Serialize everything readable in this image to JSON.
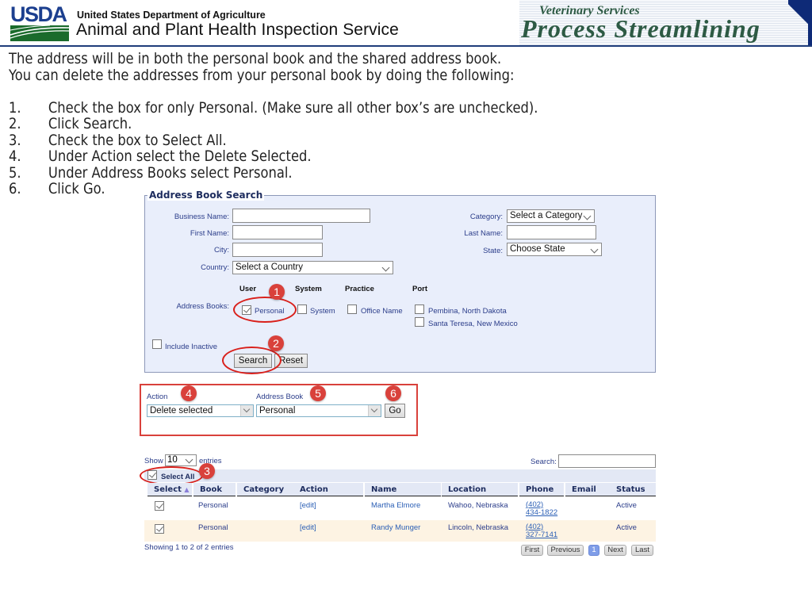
{
  "header": {
    "logo_text": "USDA",
    "department": "United States Department of Agriculture",
    "agency": "Animal and Plant Health Inspection Service",
    "banner_small": "Veterinary Services",
    "banner_large": "Process Streamlining",
    "colors": {
      "usda_blue": "#1c3f8f",
      "usda_green": "#1b6b2c",
      "banner_text": "#2d5a44",
      "banner_corner": "#0e2a77"
    }
  },
  "instructions": {
    "intro_line1": "The address will be in both the personal book and the shared address book.",
    "intro_line2": "You can delete the addresses from your personal book by doing the following:",
    "steps": [
      {
        "num": "1.",
        "text": "Check the box for only Personal.  (Make sure all other box’s are unchecked)."
      },
      {
        "num": "2.",
        "text": "Click Search."
      },
      {
        "num": "3.",
        "text": "Check the box to Select All."
      },
      {
        "num": "4.",
        "text": "Under Action select the Delete Selected."
      },
      {
        "num": "5.",
        "text": "Under Address Books select Personal."
      },
      {
        "num": "6.",
        "text": "Click Go."
      }
    ]
  },
  "search_form": {
    "legend": "Address Book Search",
    "business_name_label": "Business Name:",
    "business_name_value": "",
    "first_name_label": "First Name:",
    "first_name_value": "",
    "city_label": "City:",
    "city_value": "",
    "country_label": "Country:",
    "country_value": "Select a Country",
    "category_label": "Category:",
    "category_value": "Select a Category",
    "last_name_label": "Last Name:",
    "last_name_value": "",
    "state_label": "State:",
    "state_value": "Choose State",
    "address_books_label": "Address Books:",
    "group_headers": [
      "User",
      "System",
      "Practice",
      "Port"
    ],
    "book_options": [
      {
        "label": "Personal",
        "checked": true
      },
      {
        "label": "System",
        "checked": false
      },
      {
        "label": "Office Name",
        "checked": false
      },
      {
        "label": "Pembina, North Dakota",
        "checked": false
      },
      {
        "label": "Santa Teresa, New Mexico",
        "checked": false
      }
    ],
    "include_inactive_label": "Include Inactive",
    "include_inactive_checked": false,
    "search_button": "Search",
    "reset_button": "Reset"
  },
  "action_bar": {
    "action_label": "Action",
    "action_value": "Delete selected",
    "address_book_label": "Address Book",
    "address_book_value": "Personal",
    "go_button": "Go"
  },
  "callouts": [
    "1",
    "2",
    "3",
    "4",
    "5",
    "6"
  ],
  "results": {
    "show_label": "Show",
    "show_value": "10",
    "entries_label": "entries",
    "search_label": "Search:",
    "search_value": "",
    "select_all_label": "Select All",
    "select_all_checked": true,
    "columns": [
      "Select",
      "Book",
      "Category",
      "Action",
      "Name",
      "Location",
      "Phone",
      "Email",
      "Status"
    ],
    "rows": [
      {
        "checked": true,
        "book": "Personal",
        "category": "",
        "action": "[edit]",
        "name": "Martha Elmore",
        "location": "Wahoo, Nebraska",
        "phone_area": "(402)",
        "phone_number": "434-1822",
        "email": "",
        "status": "Active"
      },
      {
        "checked": true,
        "book": "Personal",
        "category": "",
        "action": "[edit]",
        "name": "Randy Munger",
        "location": "Lincoln, Nebraska",
        "phone_area": "(402)",
        "phone_number": "327-7141",
        "email": "",
        "status": "Active"
      }
    ],
    "info": "Showing 1 to 2 of 2 entries",
    "pagination": [
      "First",
      "Previous",
      "1",
      "Next",
      "Last"
    ],
    "current_page": "1",
    "row_alt_color": "#fdf3e3",
    "callout_color": "#d9413b"
  }
}
